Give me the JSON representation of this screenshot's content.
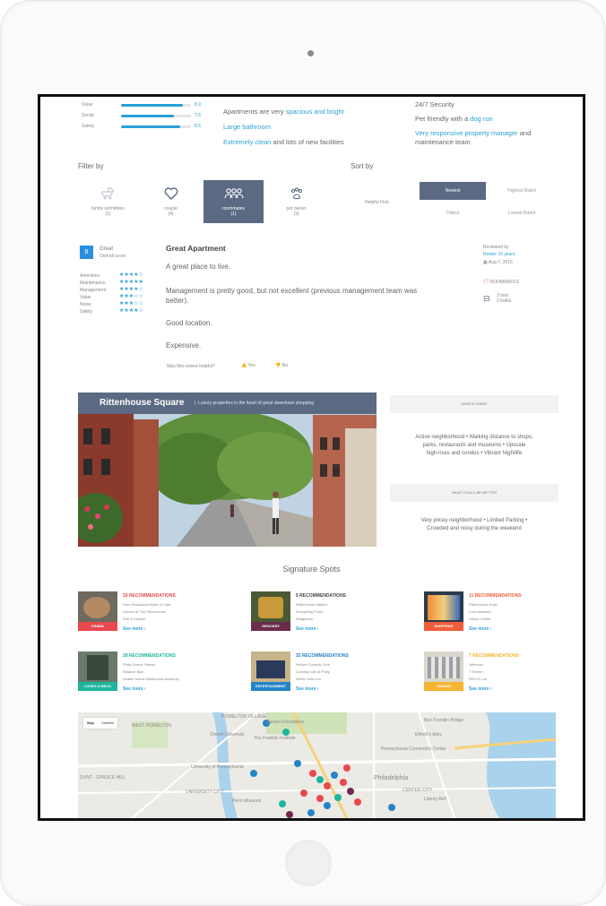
{
  "ratings": {
    "items": [
      {
        "label": "Value",
        "score": "8.9",
        "fill": 0.89
      },
      {
        "label": "Social",
        "score": "7.5",
        "fill": 0.75
      },
      {
        "label": "Safety",
        "score": "8.5",
        "fill": 0.85
      }
    ]
  },
  "highlights_left": {
    "l1_plain": "Apartments are very ",
    "l1_link": "spacious and bright",
    "l2_link": "Large bathroom",
    "l3_link": "Extremely clean",
    "l3_plain": " and lots of new facilities"
  },
  "highlights_right": {
    "l1_plain": "24/7 Security",
    "l2_plain": "Pet friendly with a ",
    "l2_link": "dog run",
    "l3_link": "Very responsive property manager",
    "l3_plain": " and",
    "l4_plain": "maintenance team"
  },
  "filter": {
    "title": "Filter by",
    "tabs": [
      {
        "label": "family w/children",
        "count": "(1)",
        "icon": "stroller-icon"
      },
      {
        "label": "couple",
        "count": "(4)",
        "icon": "heart-icon"
      },
      {
        "label": "roommates",
        "count": "(1)",
        "icon": "people-icon"
      },
      {
        "label": "pet owner",
        "count": "(3)",
        "icon": "paw-icon"
      }
    ]
  },
  "sort": {
    "title": "Sort by",
    "helpful_label": "Helpful First",
    "newest": "Newest",
    "highest": "Highest Rated",
    "oldest": "Oldest",
    "lowest": "Lowest Rated"
  },
  "review": {
    "score": "8",
    "grade": "Great",
    "subgrade": "Overall score",
    "categories": [
      "Amenities",
      "Maintenance",
      "Management",
      "Value",
      "Noise",
      "Safety"
    ],
    "title": "Great Apartment",
    "p1": "A great place to live.",
    "p2a": "Management is pretty good, but not excellent (previous management team was",
    "p2b": "better).",
    "p3": "Good location.",
    "p4": "Expensive.",
    "helpful_q": "Was this review helpful?",
    "yes": "Yes",
    "no": "No",
    "reviewed_by": "Reviewed by",
    "reviewer": "Renter 16 years",
    "date": "Aug 7, 2016",
    "room_type": "ROOMMATES",
    "bed_bath_1": "3 bed",
    "bed_bath_2": "2 baths"
  },
  "neighborhood": {
    "name": "Rittenhouse Square",
    "tagline": "Luxury properties in the heart of great downtown shopping",
    "great_title": "WHAT'S GREAT",
    "great_1": "Active neighborhood • Walking distance to shops,",
    "great_2": "parks, restaurants and museums • Upscale",
    "great_3": "high-rises and condos  • Vibrant Nightlife",
    "better_title": "WHAT COULD BE BETTER",
    "better_1": "Very pricey neighborhood • Limited Parking •",
    "better_2": "Crowded and noisy during the weekend"
  },
  "spots": {
    "title": "Signature Spots",
    "items": [
      {
        "count": "19 RECOMMENDATIONS",
        "l1": "Parc Restaurant Bistro & Cafe",
        "l2": "Lacroix at The Rittenhouse",
        "l3": "Pub & Kitchen",
        "more": "See more ›",
        "tag": "DINING",
        "color": "#e8484e"
      },
      {
        "count": "5 RECOMMENDATIONS",
        "l1": "Rittenhouse Market",
        "l2": "Everything Fresh",
        "l3": "Walgreens",
        "more": "See more ›",
        "tag": "GROCERY",
        "color": "#6b2c4f"
      },
      {
        "count": "11 RECOMMENDATIONS",
        "l1": "Rittenhouse Hotel",
        "l2": "Lora Marsden",
        "l3": "Ultimo Coffee",
        "more": "See more ›",
        "tag": "SHOPPING",
        "color": "#f05d3b"
      },
      {
        "count": "28 RECOMMENDATIONS",
        "l1": "Philly Dance Fitness",
        "l2": "Balance Bike",
        "l3": "Seattle Mixed Martial Arts Academy",
        "more": "See more ›",
        "tag": "LIVING & RECS",
        "color": "#1fb59e"
      },
      {
        "count": "32 RECOMMENDATIONS",
        "l1": "Helium Comedy Club",
        "l2": "Comedy Lab at Philly",
        "l3": "World Cafe Live",
        "more": "See more ›",
        "tag": "ENTERTAINMENT",
        "color": "#2484c6"
      },
      {
        "count": "7 RECOMMENDATIONS",
        "l1": "Jefferson",
        "l2": "7 Eleven",
        "l3": "PATCO Ltd",
        "more": "See more ›",
        "tag": "TRANSIT",
        "color": "#f5b431"
      }
    ]
  },
  "map": {
    "tab_map": "Map",
    "tab_satellite": "Satellite",
    "labels": [
      "POWELTON VILLAGE",
      "WEST POWELTON",
      "Drexel University",
      "The Franklin Institute",
      "Barnes Foundation",
      "Pennsylvania Convention Center",
      "University of Pennsylvania",
      "UNIVERSITY CITY",
      "Penn Museum",
      "Philadelphia",
      "CENTER CITY",
      "Liberty Bell",
      "Ben Franklin Bridge",
      "DUNT - SPRUCE HILL",
      "Elfreth's Alley"
    ]
  },
  "colors": {
    "accent": "#2aa0d8",
    "slate": "#5b6a82",
    "score_badge": "#2a8fe0"
  }
}
